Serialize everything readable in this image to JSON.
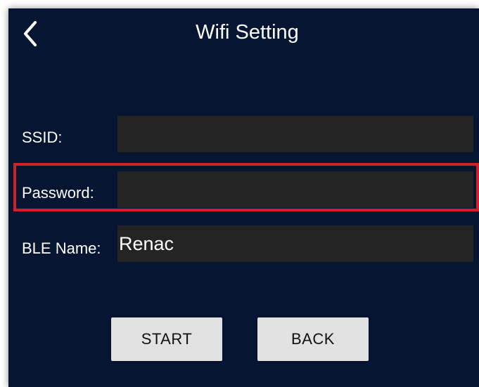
{
  "header": {
    "title": "Wifi Setting",
    "back_icon": "chevron-left-icon"
  },
  "form": {
    "ssid": {
      "label": "SSID:",
      "value": ""
    },
    "password": {
      "label": "Password:",
      "value": ""
    },
    "ble_name": {
      "label": "BLE Name:",
      "value": "Renac"
    }
  },
  "buttons": {
    "start_label": "START",
    "back_label": "BACK"
  },
  "colors": {
    "background": "#061531",
    "field_background": "#242424",
    "highlight_border": "#d0202a",
    "button_background": "#e2e2e2"
  }
}
